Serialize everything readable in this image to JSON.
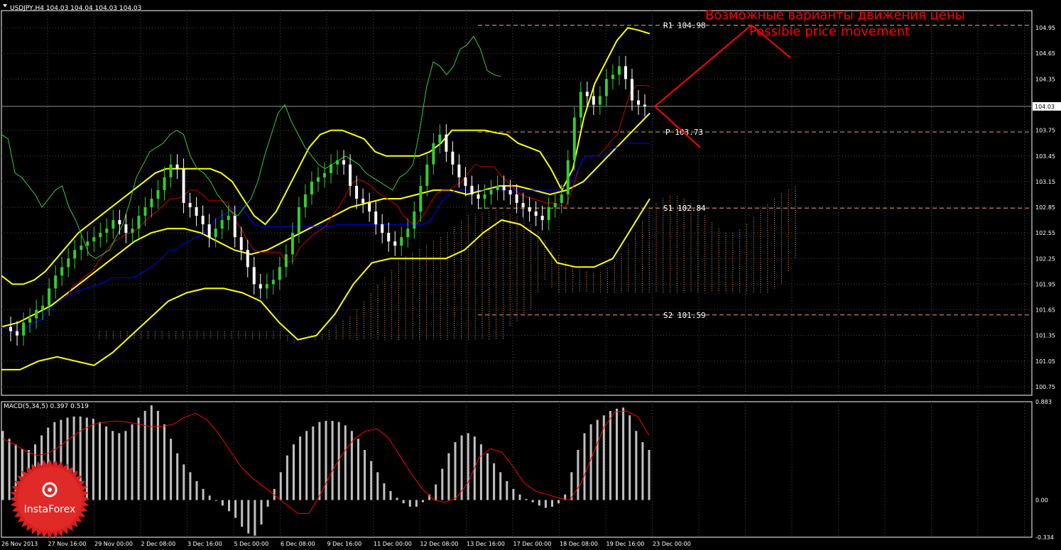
{
  "header": {
    "symbol_info": "USDJPY,H4  104.03 104.04 104.03 104.03",
    "macd_info": "MACD(5,34,5) 0.397 0.519"
  },
  "annotations": {
    "title_ru": "Возможные варианты движения цены",
    "title_en": "Possible price movement"
  },
  "logo": {
    "text": "InstaForex"
  },
  "colors": {
    "background": "#000000",
    "grid": "#4a4a4a",
    "bull_candle": "#32cd32",
    "bear_candle": "#ffffff",
    "bollinger": "#ffff00",
    "tenkan": "#cc0000",
    "kijun": "#0000ff",
    "chikou": "#32cd32",
    "cloud_up": "#f4a460",
    "cloud_down": "#d2b48c",
    "pivot_line": "#e0a080",
    "annotation": "#ff0000",
    "macd_hist": "#c0c0c0",
    "macd_signal": "#ff0000",
    "axis_text": "#ffffff"
  },
  "chart_data": [
    {
      "type": "candlestick",
      "instrument": "USDJPY",
      "timeframe": "H4",
      "ylim": [
        100.65,
        105.15
      ],
      "y_ticks": [
        "104.95",
        "104.65",
        "104.35",
        "104.03",
        "103.75",
        "103.45",
        "103.15",
        "102.85",
        "102.55",
        "102.25",
        "101.95",
        "101.65",
        "101.35",
        "101.05",
        "100.75"
      ],
      "current_price": 104.03,
      "x_ticks": [
        "26 Nov 2013",
        "27 Nov 16:00",
        "29 Nov 00:00",
        "2 Dec 08:00",
        "3 Dec 16:00",
        "5 Dec 00:00",
        "6 Dec 08:00",
        "9 Dec 16:00",
        "11 Dec 00:00",
        "12 Dec 08:00",
        "13 Dec 16:00",
        "17 Dec 00:00",
        "18 Dec 08:00",
        "19 Dec 16:00",
        "23 Dec 00:00"
      ],
      "pivot_levels": [
        {
          "label": "R1",
          "value": "104.98"
        },
        {
          "label": "P",
          "value": "103.73"
        },
        {
          "label": "S1",
          "value": "102.84"
        },
        {
          "label": "S2",
          "value": "101.59"
        }
      ],
      "close_series": [
        101.45,
        101.4,
        101.35,
        101.5,
        101.55,
        101.65,
        101.7,
        101.9,
        102.05,
        102.15,
        102.25,
        102.35,
        102.4,
        102.45,
        102.5,
        102.55,
        102.6,
        102.7,
        102.65,
        102.55,
        102.6,
        102.75,
        102.85,
        102.95,
        103.05,
        103.2,
        103.35,
        103.3,
        102.9,
        102.85,
        102.75,
        102.65,
        102.5,
        102.6,
        102.7,
        102.75,
        102.5,
        102.35,
        102.15,
        101.95,
        101.9,
        101.95,
        102.0,
        102.15,
        102.3,
        102.55,
        102.85,
        103.0,
        103.15,
        103.2,
        103.25,
        103.35,
        103.4,
        103.35,
        103.1,
        102.95,
        102.9,
        102.8,
        102.65,
        102.55,
        102.45,
        102.4,
        102.5,
        102.6,
        102.8,
        103.1,
        103.35,
        103.6,
        103.7,
        103.5,
        103.35,
        103.2,
        103.1,
        103.0,
        102.95,
        103.0,
        103.05,
        103.1,
        103.05,
        103.0,
        102.9,
        102.85,
        102.8,
        102.75,
        102.7,
        102.85,
        102.9,
        103.0,
        103.4,
        103.9,
        104.2,
        104.15,
        104.05,
        104.15,
        104.35,
        104.4,
        104.5,
        104.35,
        104.1,
        104.05,
        104.03
      ],
      "bollinger": {
        "upper": [
          102.05,
          101.95,
          101.95,
          102.0,
          102.1,
          102.25,
          102.4,
          102.55,
          102.65,
          102.75,
          102.85,
          102.95,
          103.05,
          103.15,
          103.25,
          103.3,
          103.3,
          103.3,
          103.3,
          103.3,
          103.25,
          103.15,
          102.95,
          102.75,
          102.65,
          102.8,
          103.05,
          103.3,
          103.55,
          103.7,
          103.75,
          103.75,
          103.7,
          103.65,
          103.5,
          103.45,
          103.45,
          103.45,
          103.45,
          103.5,
          103.6,
          103.75,
          103.75,
          103.75,
          103.75,
          103.72,
          103.7,
          103.6,
          103.55,
          103.5,
          103.3,
          103.05,
          103.3,
          103.9,
          104.3,
          104.55,
          104.8,
          104.95,
          104.92,
          104.88
        ],
        "middle": [
          101.45,
          101.5,
          101.6,
          101.7,
          101.85,
          102.0,
          102.15,
          102.3,
          102.45,
          102.55,
          102.6,
          102.6,
          102.55,
          102.45,
          102.35,
          102.3,
          102.35,
          102.45,
          102.55,
          102.65,
          102.75,
          102.85,
          102.9,
          102.95,
          102.95,
          103.0,
          103.05,
          103.05,
          103.0,
          103.05,
          103.1,
          103.1,
          103.05,
          103.0,
          103.05,
          103.15,
          103.35,
          103.55,
          103.75,
          103.95
        ],
        "lower": [
          100.95,
          100.95,
          101.05,
          101.1,
          101.05,
          101.0,
          101.15,
          101.35,
          101.55,
          101.75,
          101.85,
          101.9,
          101.9,
          101.85,
          101.75,
          101.5,
          101.3,
          101.35,
          101.6,
          101.95,
          102.2,
          102.25,
          102.25,
          102.25,
          102.25,
          102.35,
          102.55,
          102.7,
          102.65,
          102.5,
          102.2,
          102.15,
          102.15,
          102.25,
          102.6,
          102.95
        ]
      }
    },
    {
      "type": "bar",
      "indicator": "MACD(5,34,5)",
      "current_main": 0.397,
      "current_signal": 0.519,
      "ylim": [
        -0.334,
        0.883
      ],
      "y_ticks": [
        "0.883",
        "0.00",
        "-0.334"
      ],
      "histogram": [
        0.62,
        0.55,
        0.5,
        0.46,
        0.45,
        0.5,
        0.58,
        0.65,
        0.7,
        0.72,
        0.74,
        0.75,
        0.75,
        0.74,
        0.73,
        0.7,
        0.66,
        0.62,
        0.6,
        0.62,
        0.68,
        0.74,
        0.8,
        0.85,
        0.8,
        0.68,
        0.55,
        0.42,
        0.32,
        0.25,
        0.17,
        0.1,
        0.04,
        0.0,
        -0.05,
        -0.1,
        -0.16,
        -0.24,
        -0.3,
        -0.32,
        -0.22,
        -0.06,
        0.1,
        0.25,
        0.4,
        0.5,
        0.57,
        0.62,
        0.66,
        0.7,
        0.71,
        0.71,
        0.7,
        0.67,
        0.62,
        0.55,
        0.45,
        0.35,
        0.25,
        0.15,
        0.08,
        0.02,
        -0.03,
        -0.06,
        -0.06,
        -0.02,
        0.05,
        0.14,
        0.28,
        0.42,
        0.52,
        0.58,
        0.6,
        0.57,
        0.5,
        0.42,
        0.33,
        0.25,
        0.17,
        0.1,
        0.05,
        0.01,
        -0.02,
        -0.05,
        -0.07,
        -0.06,
        -0.03,
        0.05,
        0.25,
        0.45,
        0.6,
        0.68,
        0.72,
        0.76,
        0.8,
        0.82,
        0.83,
        0.76,
        0.62,
        0.52,
        0.45
      ],
      "signal": [
        0.55,
        0.5,
        0.44,
        0.4,
        0.42,
        0.48,
        0.56,
        0.63,
        0.68,
        0.7,
        0.71,
        0.7,
        0.68,
        0.66,
        0.66,
        0.68,
        0.74,
        0.78,
        0.72,
        0.6,
        0.45,
        0.3,
        0.2,
        0.12,
        0.04,
        -0.04,
        -0.12,
        -0.12,
        0.05,
        0.25,
        0.42,
        0.55,
        0.62,
        0.64,
        0.56,
        0.4,
        0.24,
        0.1,
        0.0,
        -0.02,
        0.02,
        0.15,
        0.38,
        0.46,
        0.43,
        0.3,
        0.15,
        0.08,
        0.05,
        0.02,
        0.0,
        0.15,
        0.4,
        0.65,
        0.79,
        0.8,
        0.75,
        0.58
      ]
    }
  ]
}
